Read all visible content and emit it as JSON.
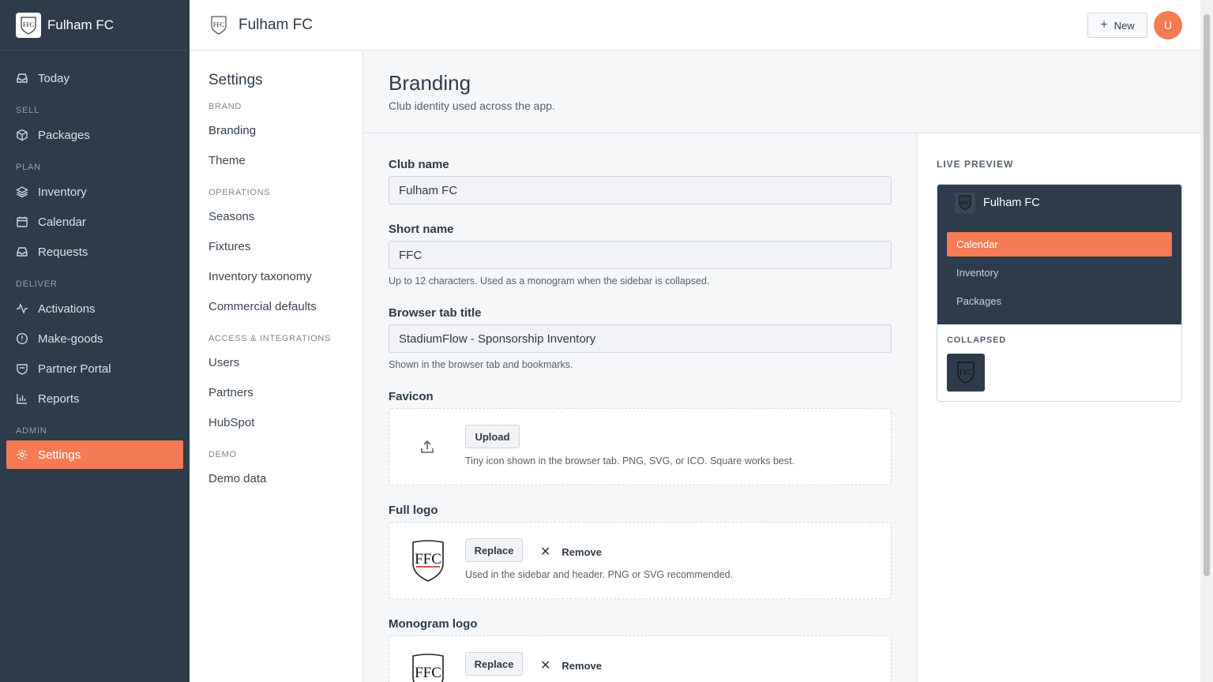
{
  "app": {
    "club_name": "Fulham FC",
    "brand_mark": "FFC"
  },
  "sidebar": {
    "items": [
      {
        "label": "Today",
        "icon": "inbox-icon"
      },
      {
        "group": "SELL"
      },
      {
        "label": "Packages",
        "icon": "package-icon"
      },
      {
        "group": "PLAN"
      },
      {
        "label": "Inventory",
        "icon": "layers-icon"
      },
      {
        "label": "Calendar",
        "icon": "calendar-icon"
      },
      {
        "label": "Requests",
        "icon": "inbox-icon"
      },
      {
        "group": "DELIVER"
      },
      {
        "label": "Activations",
        "icon": "activity-icon"
      },
      {
        "label": "Make-goods",
        "icon": "alert-circle-icon"
      },
      {
        "label": "Partner Portal",
        "icon": "portal-icon"
      },
      {
        "label": "Reports",
        "icon": "bar-chart-icon"
      },
      {
        "group": "ADMIN"
      },
      {
        "label": "Settings",
        "icon": "gear-icon",
        "active": true
      }
    ],
    "labels": {
      "today": "Today",
      "sell": "SELL",
      "packages": "Packages",
      "plan": "PLAN",
      "inventory": "Inventory",
      "calendar": "Calendar",
      "requests": "Requests",
      "deliver": "DELIVER",
      "activations": "Activations",
      "makegoods": "Make-goods",
      "partner_portal": "Partner Portal",
      "reports": "Reports",
      "admin": "ADMIN",
      "settings": "Settings"
    }
  },
  "header": {
    "title": "Fulham FC",
    "new_label": "New",
    "avatar_initial": "U",
    "accent": "#f47b53"
  },
  "settings_nav": {
    "title": "Settings",
    "brand": "BRAND",
    "branding": "Branding",
    "theme": "Theme",
    "operations": "OPERATIONS",
    "seasons": "Seasons",
    "fixtures": "Fixtures",
    "inventory_taxonomy": "Inventory taxonomy",
    "commercial_defaults": "Commercial defaults",
    "access": "ACCESS & INTEGRATIONS",
    "users": "Users",
    "partners": "Partners",
    "hubspot": "HubSpot",
    "demo": "DEMO",
    "demo_data": "Demo data"
  },
  "page": {
    "title": "Branding",
    "subtitle": "Club identity used across the app."
  },
  "form": {
    "club_name_label": "Club name",
    "club_name_value": "Fulham FC",
    "short_name_label": "Short name",
    "short_name_value": "FFC",
    "short_name_help": "Up to 12 characters. Used as a monogram when the sidebar is collapsed.",
    "tab_title_label": "Browser tab title",
    "tab_title_value": "StadiumFlow - Sponsorship Inventory",
    "tab_title_help": "Shown in the browser tab and bookmarks.",
    "favicon_label": "Favicon",
    "favicon_upload": "Upload",
    "favicon_note": "Tiny icon shown in the browser tab. PNG, SVG, or ICO. Square works best.",
    "full_logo_label": "Full logo",
    "full_logo_replace": "Replace",
    "full_logo_remove": "Remove",
    "full_logo_note": "Used in the sidebar and header. PNG or SVG recommended.",
    "monogram_label": "Monogram logo",
    "monogram_replace": "Replace",
    "monogram_remove": "Remove"
  },
  "preview": {
    "title": "LIVE PREVIEW",
    "brand": "Fulham FC",
    "items": [
      "Calendar",
      "Inventory",
      "Packages"
    ],
    "collapsed_label": "COLLAPSED"
  }
}
